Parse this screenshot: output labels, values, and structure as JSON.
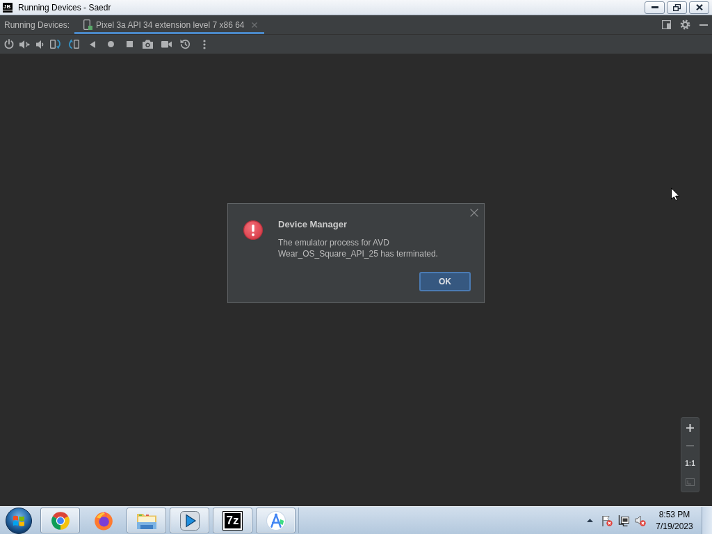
{
  "window": {
    "logo": "JB",
    "title": "Running Devices - Saedr"
  },
  "tool_window": {
    "label": "Running Devices:",
    "tabs": [
      {
        "label": "Pixel 3a API 34 extension level 7 x86 64",
        "selected": true
      }
    ]
  },
  "dialog": {
    "title": "Device Manager",
    "message": "The emulator process for AVD Wear_OS_Square_API_25 has terminated.",
    "buttons": [
      "OK"
    ]
  },
  "zoom_controls": [
    {
      "kind": "plus",
      "disabled": false
    },
    {
      "kind": "minus",
      "disabled": true
    },
    {
      "kind": "text",
      "label": "1:1",
      "disabled": false
    },
    {
      "kind": "fit",
      "disabled": true
    }
  ],
  "taskbar": {
    "apps": [
      {
        "kind": "chrome",
        "running": true
      },
      {
        "kind": "firefox",
        "running": false
      },
      {
        "kind": "explorer",
        "running": true
      },
      {
        "kind": "media",
        "running": true
      },
      {
        "kind": "archiver",
        "label": "7z",
        "running": true
      },
      {
        "kind": "studio",
        "running": true
      }
    ],
    "clock": {
      "time": "8:53 PM",
      "date": "7/19/2023"
    }
  }
}
